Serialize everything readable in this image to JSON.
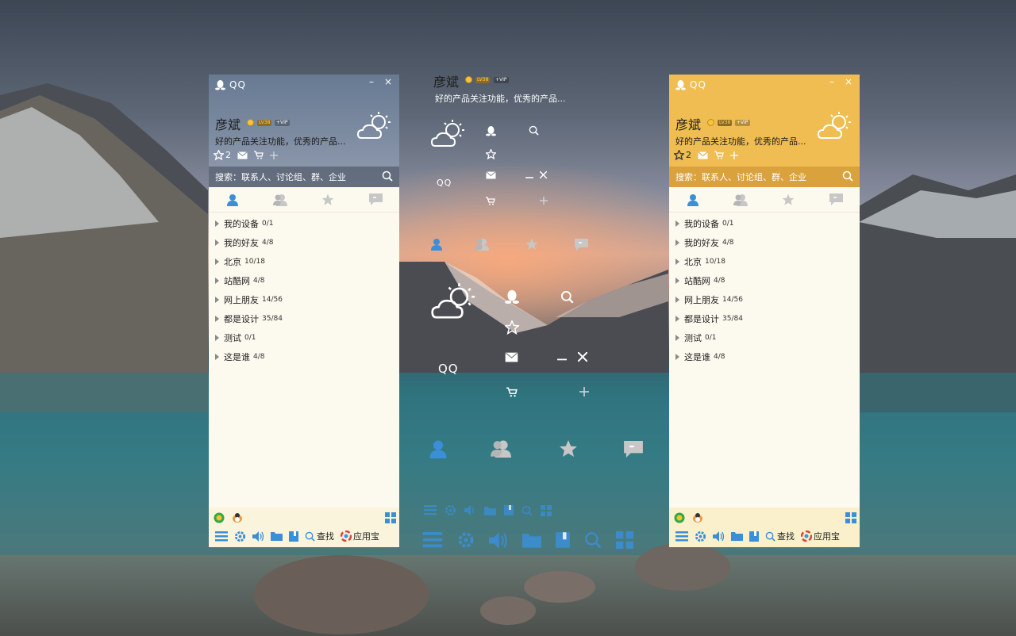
{
  "app": {
    "name": "QQ"
  },
  "user": {
    "name": "彦斌",
    "level_badge": "LV38",
    "vip_badge": "+VIP",
    "signature": "好的产品关注功能，优秀的产品..."
  },
  "window_controls": {
    "minimize": "–",
    "close": "×"
  },
  "toolbar": {
    "star_count": "2"
  },
  "search": {
    "placeholder": "搜索：联系人、讨论组、群、企业"
  },
  "groups": [
    {
      "label": "我的设备",
      "count": "0/1"
    },
    {
      "label": "我的好友",
      "count": "4/8"
    },
    {
      "label": "北京",
      "count": "10/18"
    },
    {
      "label": "站酷网",
      "count": "4/8"
    },
    {
      "label": "网上朋友",
      "count": "14/56"
    },
    {
      "label": "都是设计",
      "count": "35/84"
    },
    {
      "label": "测试",
      "count": "0/1"
    },
    {
      "label": "这是谁",
      "count": "4/8"
    }
  ],
  "bottom": {
    "find_label": "查找",
    "appstore_label": "应用宝"
  },
  "center_showcase": {
    "name": "彦斌",
    "level_badge": "LV38",
    "vip_badge": "+VIP",
    "signature": "好的产品关注功能，优秀的产品...",
    "qq_small": "QQ",
    "qq_large": "QQ"
  },
  "themes": {
    "blue": "#6f7f97",
    "yellow": "#f0bd52",
    "accent_blue": "#3a8fd8"
  }
}
